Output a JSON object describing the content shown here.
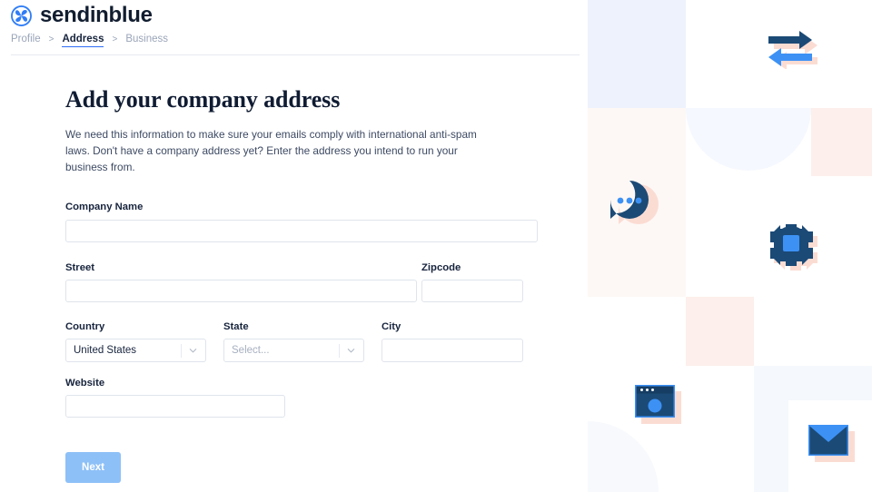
{
  "brand": {
    "name": "sendinblue",
    "logo_icon": "sendinblue-swirl-icon",
    "logo_color": "#2f7df6"
  },
  "breadcrumb": {
    "items": [
      {
        "label": "Profile",
        "active": false
      },
      {
        "label": "Address",
        "active": true
      },
      {
        "label": "Business",
        "active": false
      }
    ],
    "separator": ">"
  },
  "page": {
    "title": "Add your company address",
    "subtitle": "We need this information to make sure your emails comply with international anti-spam laws. Don't have a company address yet? Enter the address you intend to run your business from."
  },
  "form": {
    "company_name": {
      "label": "Company Name",
      "value": "",
      "placeholder": ""
    },
    "street": {
      "label": "Street",
      "value": "",
      "placeholder": ""
    },
    "zipcode": {
      "label": "Zipcode",
      "value": "",
      "placeholder": ""
    },
    "country": {
      "label": "Country",
      "value": "United States",
      "is_placeholder": false
    },
    "state": {
      "label": "State",
      "value": "Select...",
      "is_placeholder": true
    },
    "city": {
      "label": "City",
      "value": "",
      "placeholder": ""
    },
    "website": {
      "label": "Website",
      "value": "",
      "placeholder": ""
    },
    "submit_label": "Next",
    "submit_color": "#8dc0f7",
    "submit_disabled": true,
    "caret_icon": "chevron-down-icon"
  },
  "decoration": {
    "palette": {
      "navy": "#1b4a76",
      "blue": "#3d91f5",
      "peach": "#fbdcd3",
      "pale_blue_square": "#edf2fd",
      "pale_peach_square": "#fdf7f4",
      "pink_square": "#fdefeb",
      "pale_blue_circle": "#f5f8fe",
      "very_pale_blue": "#f5f8fd"
    },
    "icons": [
      {
        "name": "arrows-exchange-icon",
        "label": "two-way arrows"
      },
      {
        "name": "chat-bubble-icon",
        "label": "chat bubble with three dots"
      },
      {
        "name": "gear-icon",
        "label": "settings cog"
      },
      {
        "name": "browser-window-icon",
        "label": "browser window"
      },
      {
        "name": "envelope-icon",
        "label": "email envelope"
      }
    ]
  }
}
